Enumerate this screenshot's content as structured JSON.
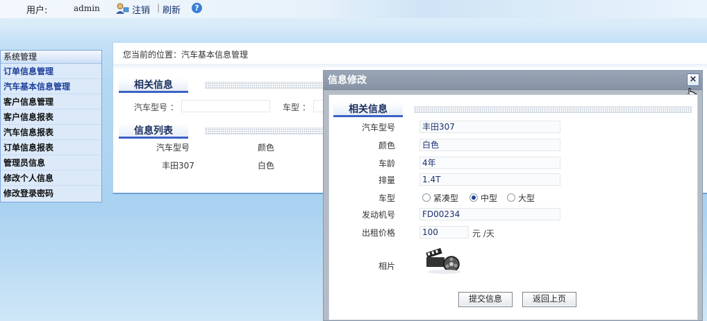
{
  "header": {
    "user_label": "用户:",
    "user_name": "admin",
    "logout": "注销",
    "separator": "|",
    "refresh": "刷新",
    "help_glyph": "?"
  },
  "sidebar": {
    "heading": "系统管理",
    "items": [
      {
        "label": "订单信息管理",
        "active": true
      },
      {
        "label": "汽车基本信息管理",
        "active": true
      },
      {
        "label": "客户信息管理",
        "active": false
      },
      {
        "label": "客户信息报表",
        "active": false
      },
      {
        "label": "汽车信息报表",
        "active": false
      },
      {
        "label": "订单信息报表",
        "active": false
      },
      {
        "label": "管理员信息",
        "active": false
      },
      {
        "label": "修改个人信息",
        "active": false
      },
      {
        "label": "修改登录密码",
        "active": false
      }
    ]
  },
  "main": {
    "breadcrumb": "您当前的位置：汽车基本信息管理",
    "related_section": "相关信息",
    "search": {
      "model_label": "汽车型号 ：",
      "type_label": "车型 ："
    },
    "list_section": "信息列表",
    "table": {
      "headers": [
        "汽车型号",
        "颜色"
      ],
      "rows": [
        [
          "丰田307",
          "白色"
        ]
      ]
    }
  },
  "dialog": {
    "title": "信息修改",
    "close_glyph": "×",
    "section": "相关信息",
    "fields": {
      "model": {
        "label": "汽车型号",
        "value": "丰田307"
      },
      "color": {
        "label": "颜色",
        "value": "白色"
      },
      "age": {
        "label": "车龄",
        "value": "4年"
      },
      "displacement": {
        "label": "排量",
        "value": "1.4T"
      },
      "type": {
        "label": "车型",
        "options": [
          "紧凑型",
          "中型",
          "大型"
        ],
        "selected": "中型"
      },
      "engine": {
        "label": "发动机号",
        "value": "FD00234"
      },
      "price": {
        "label": "出租价格",
        "value": "100",
        "unit": "元 /天"
      },
      "photo": {
        "label": "相片"
      }
    },
    "buttons": {
      "submit": "提交信息",
      "back": "返回上页"
    }
  },
  "colors": {
    "accent": "#3a62c4",
    "sidebar_bg": "#dbe9f9",
    "dialog_title": "#8693a5"
  }
}
